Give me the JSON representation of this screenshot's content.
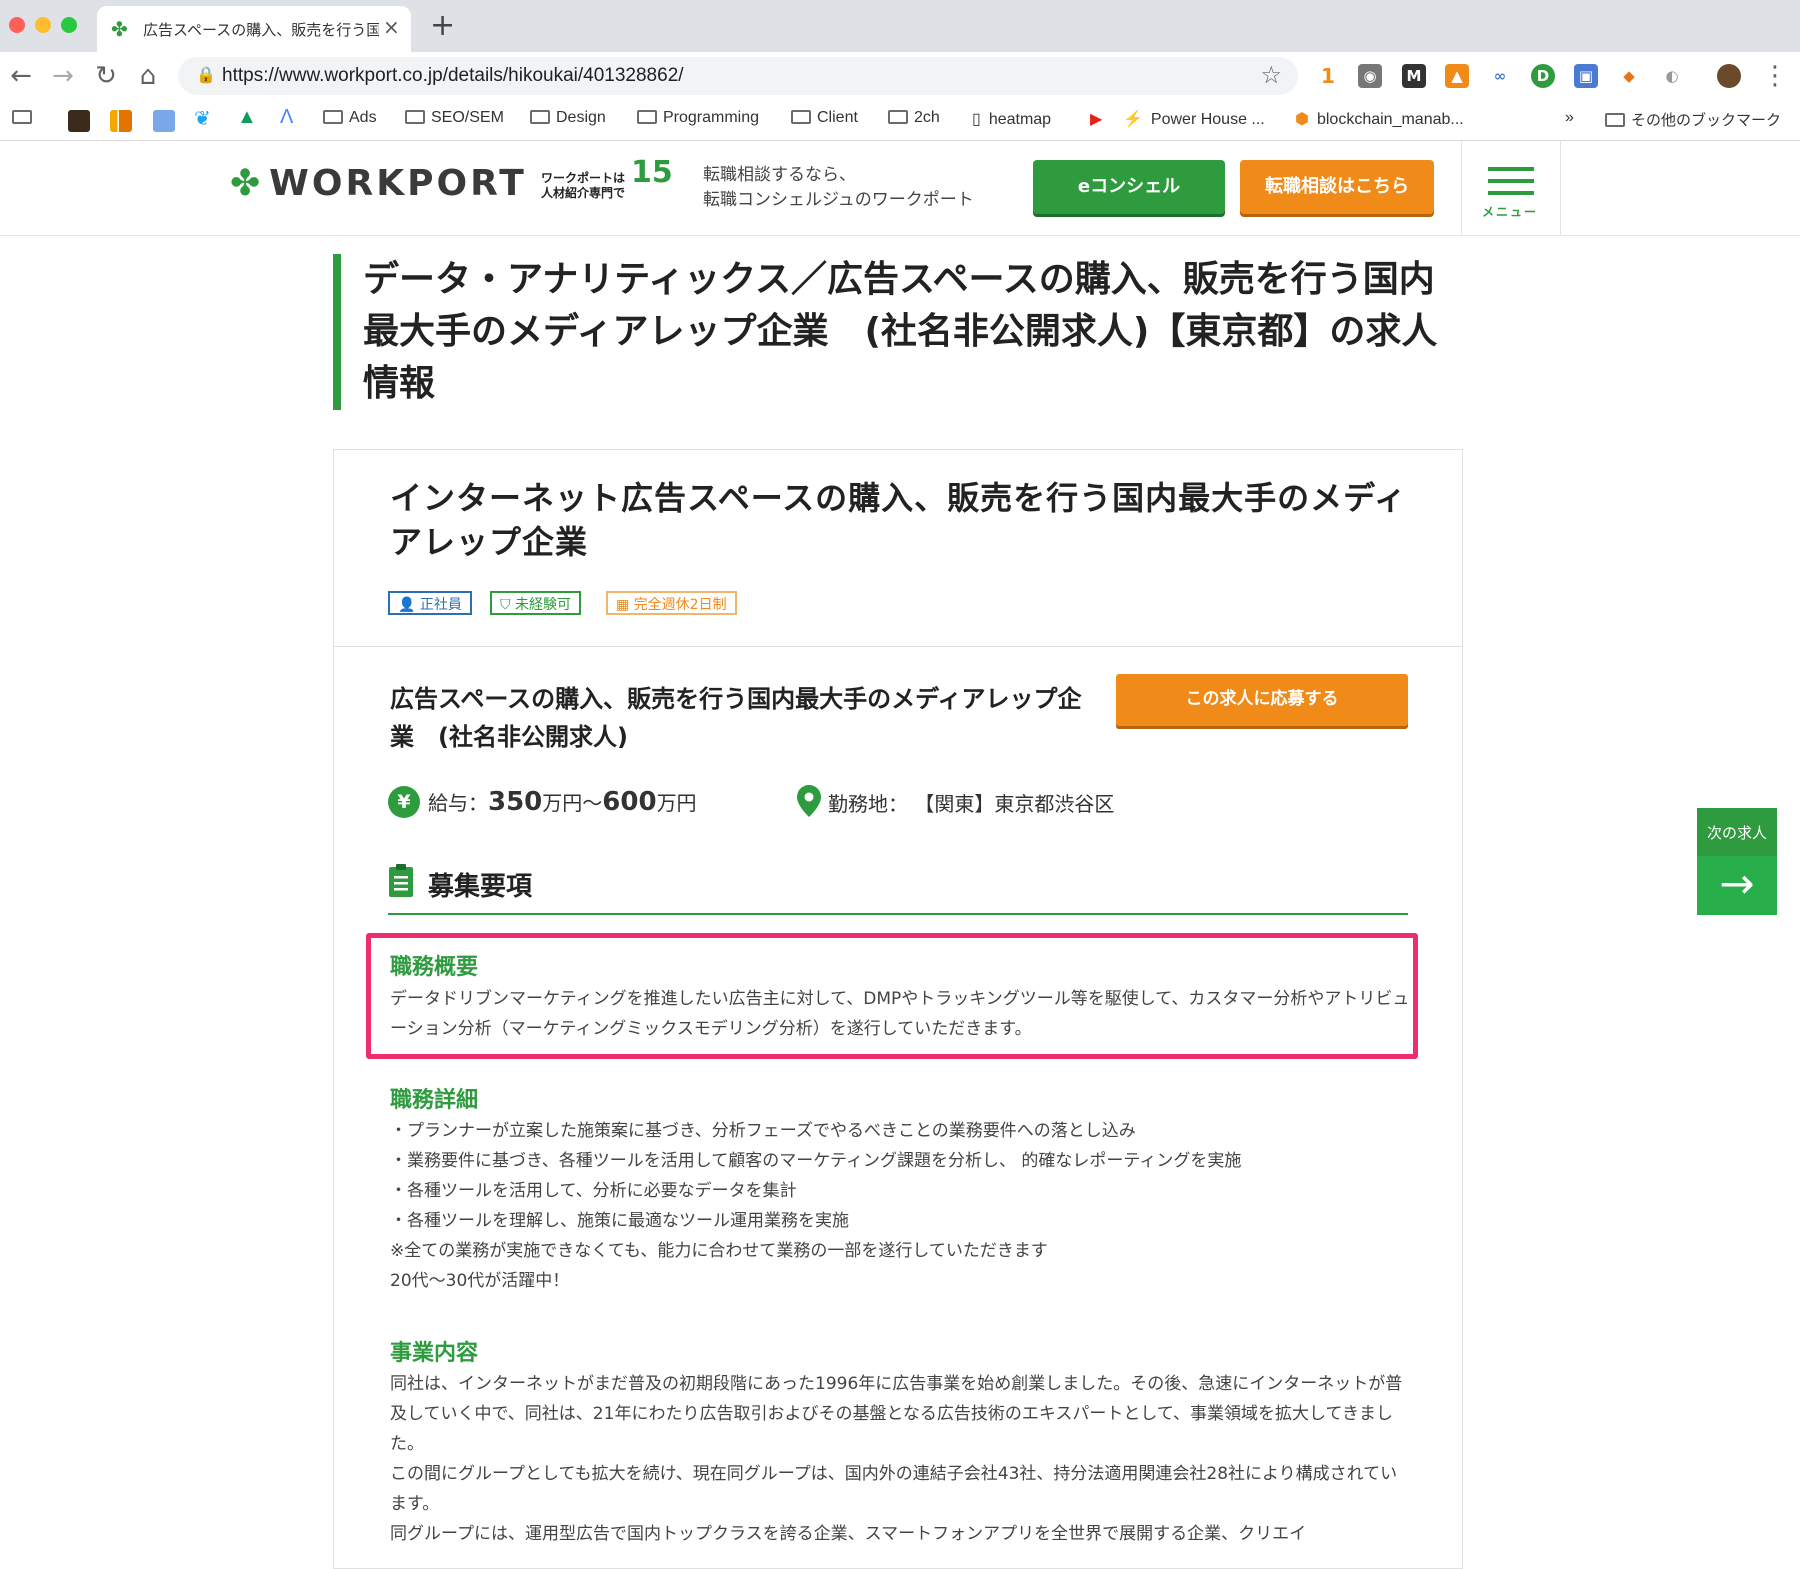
{
  "browser": {
    "tab_title": "広告スペースの購入、販売を行う国",
    "tab_close": "×",
    "new_tab": "+",
    "url": "https://www.workport.co.jp/details/hikoukai/401328862/",
    "extension_badge": "1",
    "bookmarks": [
      "Ads",
      "SEO/SEM",
      "Design",
      "Programming",
      "Client",
      "2ch",
      "heatmap",
      "Power House ...",
      "blockchain_manab...",
      "»",
      "その他のブックマーク"
    ]
  },
  "header": {
    "logo": "WORKPORT",
    "badge_line1": "ワークポートは",
    "badge_line2": "人材紹介専門で",
    "badge_years": "15",
    "tagline_line1": "転職相談するなら、",
    "tagline_line2": "転職コンシェルジュのワークポート",
    "concierge_button": "eコンシェル",
    "consult_button": "転職相談はこちら",
    "menu_label": "メニュー"
  },
  "page": {
    "title": "データ・アナリティックス／広告スペースの購入、販売を行う国内最大手のメディアレップ企業　(社名非公開求人)【東京都】の求人情報"
  },
  "job": {
    "card_title": "インターネット広告スペースの購入、販売を行う国内最大手のメディアレップ企業",
    "tags": [
      "正社員",
      "未経験可",
      "完全週休2日制"
    ],
    "company_title": "広告スペースの購入、販売を行う国内最大手のメディアレップ企業　(社名非公開求人)",
    "apply_button": "この求人に応募する",
    "salary_label": "給与：",
    "salary_min": "350",
    "salary_unit1": "万円〜",
    "salary_max": "600",
    "salary_unit2": "万円",
    "location_label": "勤務地：",
    "location_value": "【関東】東京都渋谷区",
    "section_heading": "募集要項",
    "overview_heading": "職務概要",
    "overview_text": "データドリブンマーケティングを推進したい広告主に対して、DMPやトラッキングツール等を駆使して、カスタマー分析やアトリビューション分析（マーケティングミックスモデリング分析）を遂行していただきます。",
    "details_heading": "職務詳細",
    "details_lines": [
      "・プランナーが立案した施策案に基づき、分析フェーズでやるべきことの業務要件への落とし込み",
      "・業務要件に基づき、各種ツールを活用して顧客のマーケティング課題を分析し、 的確なレポーティングを実施",
      "・各種ツールを活用して、分析に必要なデータを集計",
      "・各種ツールを理解し、施策に最適なツール運用業務を実施",
      "※全ての業務が実施できなくても、能力に合わせて業務の一部を遂行していただきます",
      "20代〜30代が活躍中！"
    ],
    "business_heading": "事業内容",
    "business_lines": [
      "同社は、インターネットがまだ普及の初期段階にあった1996年に広告事業を始め創業しました。その後、急速にインターネットが普及していく中で、同社は、21年にわたり広告取引およびその基盤となる広告技術のエキスパートとして、事業領域を拡大してきました。",
      "この間にグループとしても拡大を続け、現在同グループは、国内外の連結子会社43社、持分法適用関連会社28社により構成されています。",
      "同グループには、運用型広告で国内トップクラスを誇る企業、スマートフォンアプリを全世界で展開する企業、クリエイ"
    ]
  },
  "side": {
    "next_job_label": "次の求人",
    "next_arrow": "→"
  },
  "colors": {
    "brand_green": "#2e9b3f",
    "accent_orange": "#f08a19",
    "highlight_pink": "#ee2c70"
  }
}
